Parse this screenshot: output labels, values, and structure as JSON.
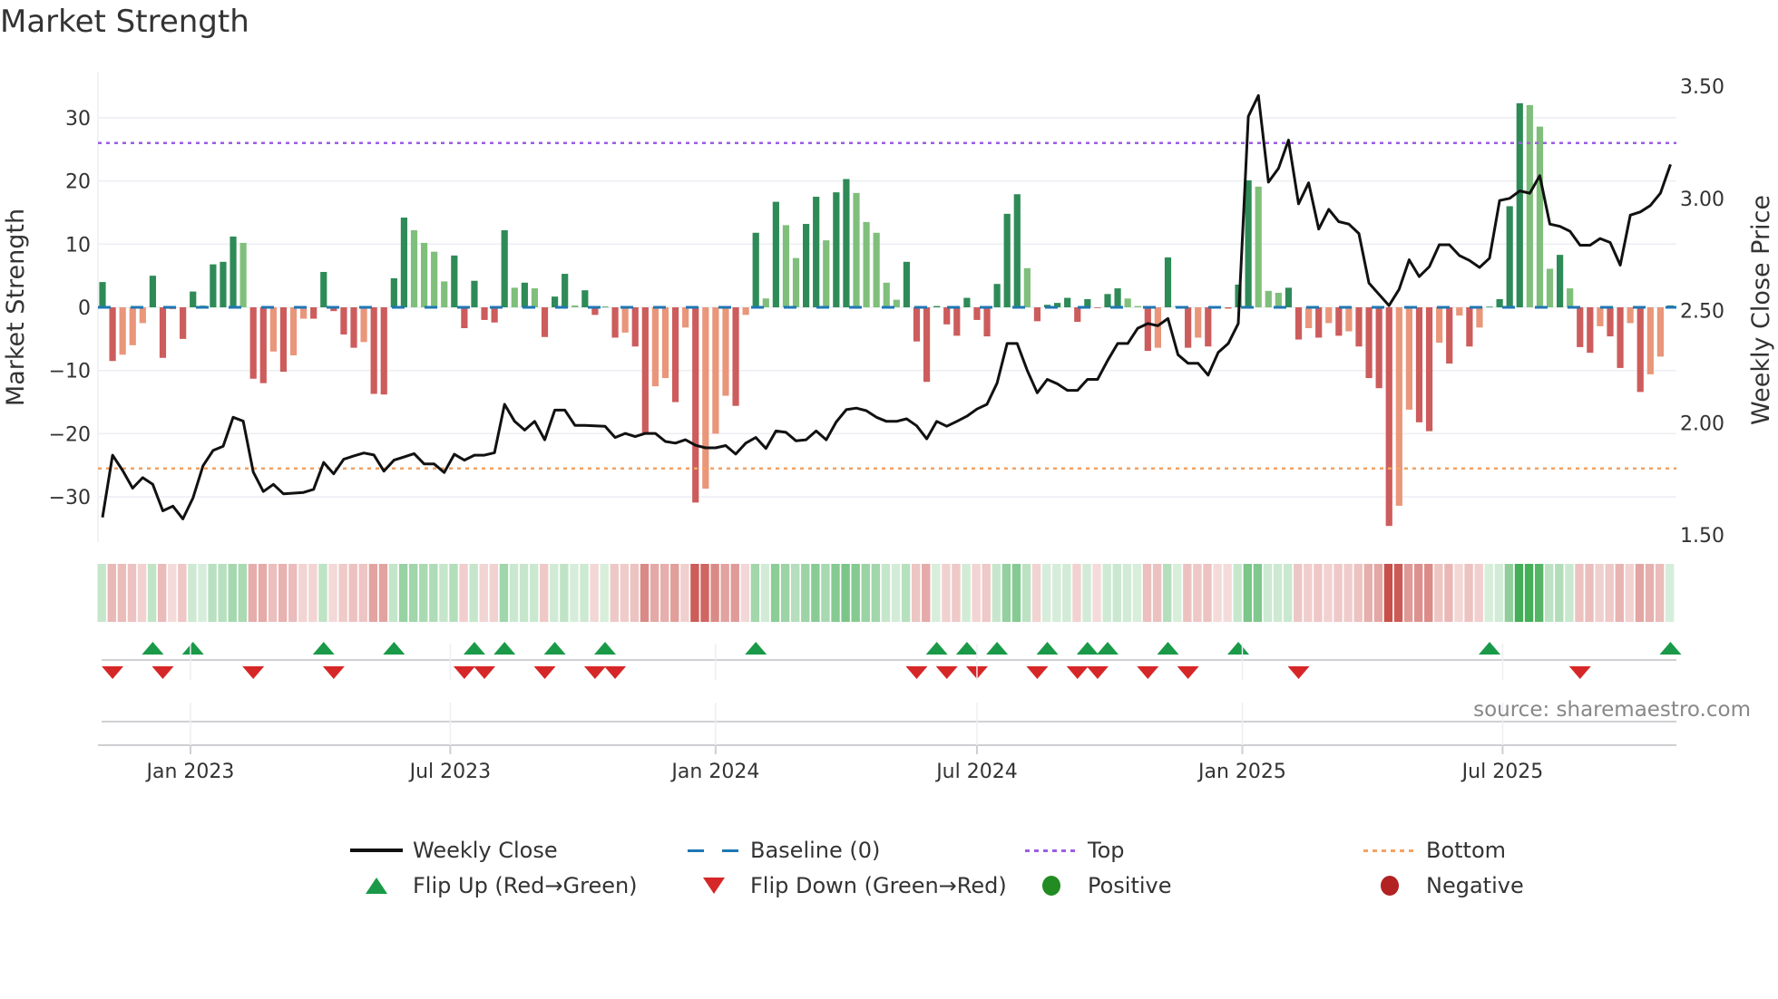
{
  "title": "Market Strength",
  "source": "source: sharemaestro.com",
  "colors": {
    "pos_strong": "#2e8b57",
    "pos_weak": "#7fbf7b",
    "neg_strong": "#cd5c5c",
    "neg_weak": "#e9967a",
    "baseline": "#1f77b4",
    "top": "#9b5de5",
    "bottom": "#f4a261",
    "close": "#111111",
    "flip_up": "#1a9a48",
    "flip_down": "#d62728",
    "positive": "#228b22",
    "negative": "#b22222"
  },
  "legend": {
    "weekly_close": "Weekly Close",
    "baseline": "Baseline (0)",
    "top": "Top",
    "bottom": "Bottom",
    "flip_up": "Flip Up (Red→Green)",
    "flip_down": "Flip Down (Green→Red)",
    "positive": "Positive",
    "negative": "Negative"
  },
  "chart_data": {
    "type": "bar",
    "title": "Market Strength",
    "ylabel": "Market Strength",
    "y2label": "Weekly Close Price",
    "ylim": [
      -37,
      37
    ],
    "y2lim": [
      1.45,
      3.6
    ],
    "yticks": [
      "30",
      "20",
      "10",
      "0",
      "−10",
      "−20",
      "−30"
    ],
    "ytick_values": [
      30,
      20,
      10,
      0,
      -10,
      -20,
      -30
    ],
    "y2ticks": [
      "3.50",
      "3.00",
      "2.50",
      "2.00",
      "1.50"
    ],
    "y2tick_values": [
      3.5,
      3.0,
      2.5,
      2.0,
      1.5
    ],
    "xticks": [
      "Jan 2023",
      "Jul 2023",
      "Jan 2024",
      "Jul 2024",
      "Jan 2025",
      "Jul 2025"
    ],
    "xtick_week_index": [
      8.75,
      34.6,
      61,
      87,
      113.4,
      139.3
    ],
    "top_level": 26,
    "bottom_level": -25.5,
    "baseline_level": 0,
    "strength": [
      4,
      -8.5,
      -7.5,
      -6,
      -2.5,
      5,
      -8,
      -0.3,
      -5,
      2.5,
      0.3,
      6.8,
      7.2,
      11.2,
      10.2,
      -11.3,
      -12,
      -7,
      -10.2,
      -7.6,
      -1.8,
      -1.8,
      5.6,
      -0.6,
      -4.3,
      -6.4,
      -5.5,
      -13.7,
      -13.8,
      4.6,
      14.2,
      12.2,
      10.2,
      8.8,
      4.1,
      8.2,
      -3.3,
      4.2,
      -2,
      -2.4,
      12.2,
      3.1,
      3.9,
      3,
      -4.7,
      1.7,
      5.3,
      0.3,
      2.7,
      -1.2,
      0.1,
      -4.8,
      -4,
      -6.2,
      -20,
      -12.5,
      -11.2,
      -15,
      -3.2,
      -30.9,
      -28.7,
      -20,
      -14,
      -15.6,
      -1.2,
      11.8,
      1.4,
      16.7,
      13,
      7.8,
      13.2,
      17.5,
      10.6,
      18.2,
      20.3,
      18.1,
      13.5,
      11.8,
      3.9,
      1.2,
      7.2,
      -5.4,
      -11.8,
      0.2,
      -2.7,
      -4.5,
      1.5,
      -2,
      -4.6,
      3.7,
      14.8,
      17.9,
      6.2,
      -2.2,
      0.4,
      0.7,
      1.5,
      -2.3,
      1.3,
      -0.1,
      2.1,
      3,
      1.4,
      0.2,
      -6.9,
      -6.4,
      7.9,
      0.2,
      -6.4,
      -4.8,
      -6.2,
      -0.1,
      -0.2,
      3.6,
      20.1,
      19.1,
      2.6,
      2.3,
      3.1,
      -5.1,
      -3.3,
      -4.8,
      -2.5,
      -4.5,
      -3.8,
      -6.2,
      -11.2,
      -12.8,
      -34.6,
      -31.4,
      -16.2,
      -18.2,
      -19.6,
      -5.6,
      -8.9,
      -1.3,
      -6.2,
      -3.2,
      0.1,
      1.3,
      16,
      32.3,
      32,
      28.6,
      6.1,
      8.3,
      3,
      -6.3,
      -7.2,
      -3,
      -4.6,
      -9.6,
      -2.5,
      -13.4,
      -10.6,
      -7.8,
      0.3
    ],
    "weekly_close": [
      1.578,
      1.855,
      1.787,
      1.708,
      1.755,
      1.725,
      1.607,
      1.628,
      1.571,
      1.664,
      1.808,
      1.876,
      1.895,
      2.024,
      2.007,
      1.78,
      1.693,
      1.725,
      1.683,
      1.686,
      1.689,
      1.703,
      1.823,
      1.772,
      1.837,
      1.852,
      1.865,
      1.856,
      1.784,
      1.833,
      1.847,
      1.862,
      1.816,
      1.816,
      1.778,
      1.859,
      1.833,
      1.855,
      1.855,
      1.866,
      2.082,
      2.006,
      1.967,
      2.006,
      1.924,
      2.056,
      2.056,
      1.988,
      1.988,
      1.986,
      1.984,
      1.934,
      1.952,
      1.938,
      1.952,
      1.952,
      1.916,
      1.909,
      1.924,
      1.899,
      1.888,
      1.888,
      1.898,
      1.86,
      1.909,
      1.934,
      1.885,
      1.963,
      1.957,
      1.919,
      1.924,
      1.963,
      1.924,
      2.003,
      2.058,
      2.065,
      2.053,
      2.024,
      2.006,
      2.006,
      2.017,
      1.986,
      1.928,
      2.006,
      1.984,
      2.006,
      2.029,
      2.061,
      2.082,
      2.176,
      2.353,
      2.353,
      2.233,
      2.133,
      2.193,
      2.173,
      2.144,
      2.144,
      2.193,
      2.193,
      2.277,
      2.353,
      2.353,
      2.421,
      2.442,
      2.432,
      2.464,
      2.303,
      2.265,
      2.265,
      2.212,
      2.313,
      2.353,
      2.442,
      3.365,
      3.458,
      3.072,
      3.134,
      3.259,
      2.975,
      3.069,
      2.863,
      2.951,
      2.896,
      2.885,
      2.843,
      2.622,
      2.572,
      2.522,
      2.594,
      2.726,
      2.651,
      2.695,
      2.793,
      2.793,
      2.745,
      2.723,
      2.692,
      2.733,
      2.99,
      3.0,
      3.033,
      3.023,
      3.101,
      2.885,
      2.875,
      2.853,
      2.791,
      2.791,
      2.821,
      2.803,
      2.702,
      2.925,
      2.939,
      2.968,
      3.023,
      3.151
    ]
  }
}
